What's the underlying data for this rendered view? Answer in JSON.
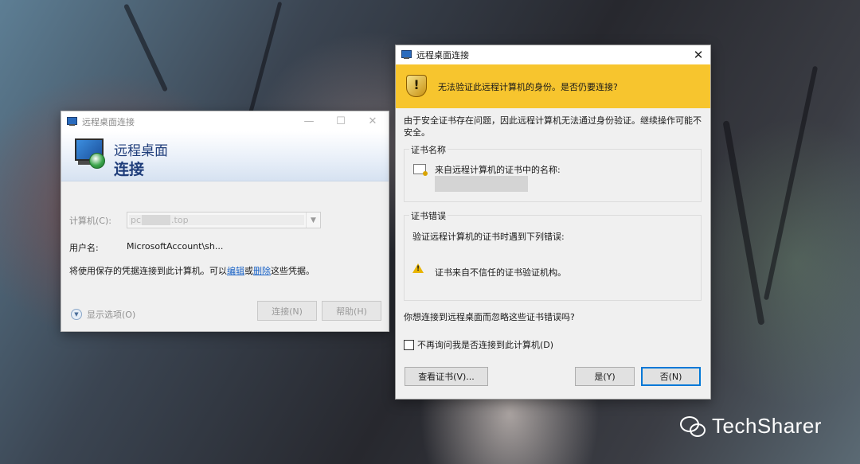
{
  "left_dialog": {
    "title": "远程桌面连接",
    "banner_line1": "远程桌面",
    "banner_line2": "连接",
    "computer_label": "计算机(C):",
    "computer_value_prefix": "pc",
    "computer_value_suffix": ".top",
    "username_label": "用户名:",
    "username_value": "MicrosoftAccount\\sh...",
    "info_text_before": "将使用保存的凭据连接到此计算机。可以",
    "edit_link": "编辑",
    "or_text": "或",
    "delete_link": "删除",
    "info_text_after": "这些凭据。",
    "show_options": "显示选项(O)",
    "connect_button": "连接(N)",
    "help_button": "帮助(H)",
    "minimize_glyph": "—",
    "maximize_glyph": "☐",
    "close_glyph": "✕"
  },
  "cert_dialog": {
    "title": "远程桌面连接",
    "close_glyph": "✕",
    "warning_message": "无法验证此远程计算机的身份。是否仍要连接?",
    "intro_text": "由于安全证书存在问题，因此远程计算机无法通过身份验证。继续操作可能不安全。",
    "cert_name_group_title": "证书名称",
    "cert_name_label": "来自远程计算机的证书中的名称:",
    "cert_error_group_title": "证书错误",
    "cert_error_intro": "验证远程计算机的证书时遇到下列错误:",
    "cert_error_item": "证书来自不信任的证书验证机构。",
    "question": "你想连接到远程桌面而忽略这些证书错误吗?",
    "dont_ask_checkbox": "不再询问我是否连接到此计算机(D)",
    "dont_ask_checked": false,
    "view_cert_button": "查看证书(V)...",
    "yes_button": "是(Y)",
    "no_button": "否(N)"
  },
  "watermark": {
    "text": "TechSharer",
    "icon": "wechat-icon"
  }
}
